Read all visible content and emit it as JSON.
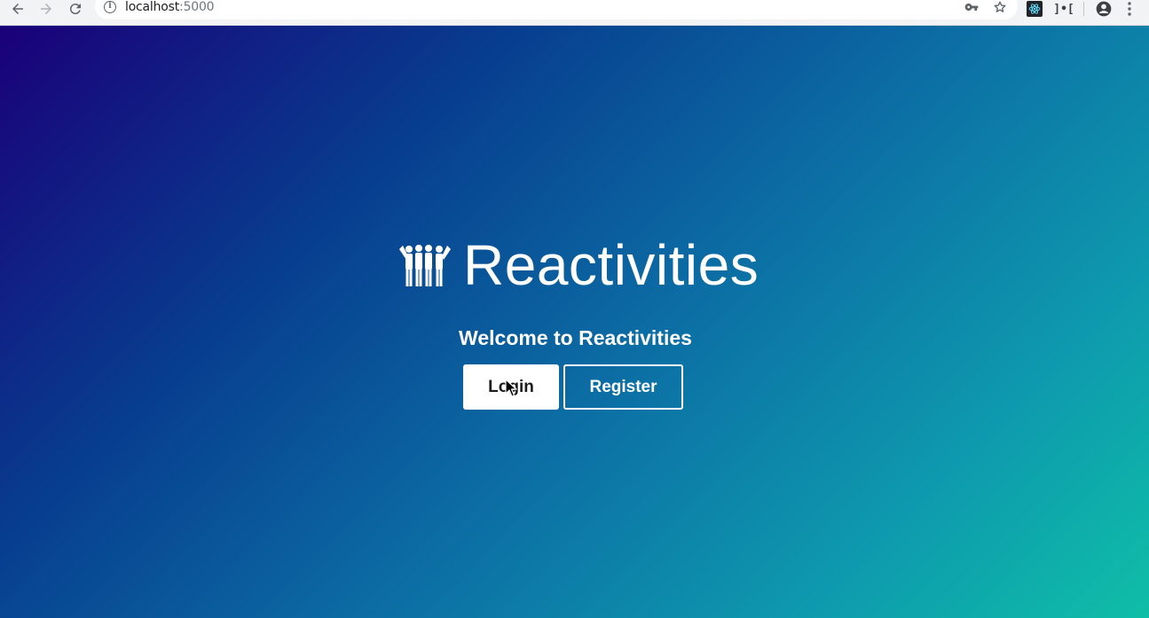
{
  "browser": {
    "url_host": "localhost",
    "url_port": ":5000",
    "icons": {
      "back": "arrow-left-icon",
      "forward": "arrow-right-icon",
      "reload": "reload-icon",
      "info": "info-icon",
      "key": "key-icon",
      "bookmark": "star-icon",
      "react_devtools": "react-icon",
      "redux_devtools": "bracket-icon",
      "account": "account-icon",
      "menu": "kebab-menu-icon"
    },
    "info_glyph": "i",
    "bracket_ext_text": "]•["
  },
  "page": {
    "brand_title": "Reactivities",
    "welcome": "Welcome to Reactivities",
    "login_label": "Login",
    "register_label": "Register",
    "logo_icon": "users-group-icon"
  },
  "colors": {
    "gradient_start": "#1a0079",
    "gradient_end": "#0fbea7",
    "text": "#ffffff"
  }
}
